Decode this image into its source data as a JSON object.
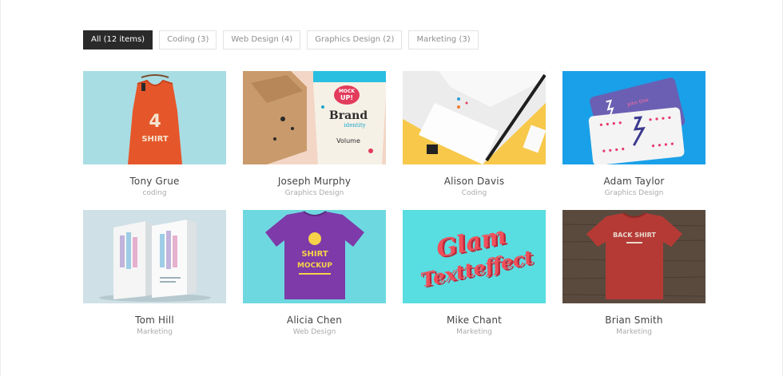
{
  "filters": [
    {
      "label": "All (12 items)",
      "active": true
    },
    {
      "label": "Coding (3)",
      "active": false
    },
    {
      "label": "Web Design (4)",
      "active": false
    },
    {
      "label": "Graphics Design (2)",
      "active": false
    },
    {
      "label": "Marketing (3)",
      "active": false
    }
  ],
  "portfolio": [
    {
      "name": "Tony Grue",
      "category": "coding",
      "image": "orange-tank-top-mockup",
      "bg": "#a9dde4"
    },
    {
      "name": "Joseph Murphy",
      "category": "Graphics Design",
      "image": "paper-cup-brand-mockup",
      "bg": "#f3d6c6"
    },
    {
      "name": "Alison Davis",
      "category": "Coding",
      "image": "stationery-branding-mockup",
      "bg": "#f7c84a"
    },
    {
      "name": "Adam Taylor",
      "category": "Graphics Design",
      "image": "business-cards-mockup",
      "bg": "#1aa0e8"
    },
    {
      "name": "Tom Hill",
      "category": "Marketing",
      "image": "package-boxes-mockup",
      "bg": "#cfe0e6"
    },
    {
      "name": "Alicia Chen",
      "category": "Web Design",
      "image": "purple-tshirt-mockup",
      "bg": "#6ed8e0"
    },
    {
      "name": "Mike Chant",
      "category": "Marketing",
      "image": "3d-lettering-mockup",
      "bg": "#58dde0"
    },
    {
      "name": "Brian Smith",
      "category": "Marketing",
      "image": "red-tshirt-on-wood-mockup",
      "bg": "#5a4a3e"
    }
  ],
  "image_text": {
    "cup_mock": "MOCK",
    "cup_up": "UP!",
    "cup_brand": "Brand",
    "cup_identity": "identity",
    "cup_volume": "Volume",
    "tank_shirt": "SHIRT",
    "card_name": "John Doe",
    "tee_shirt": "SHIRT",
    "tee_mockup": "MOCKUP",
    "glam1": "Glam",
    "glam2": "Textteffect",
    "wood_tee": "BACK SHIRT"
  }
}
